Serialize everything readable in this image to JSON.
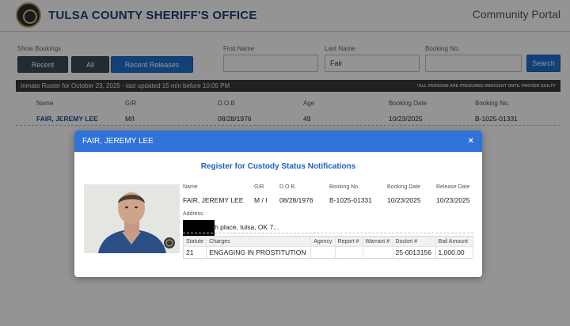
{
  "header": {
    "org_title": "TULSA COUNTY SHERIFF'S OFFICE",
    "portal_title": "Community Portal"
  },
  "filters": {
    "show_bookings_label": "Show Bookings",
    "buttons": [
      "Recent",
      "All",
      "Recent Releases"
    ],
    "first_name": {
      "label": "First Name",
      "value": ""
    },
    "last_name": {
      "label": "Last Name",
      "value": "Fair"
    },
    "booking_no": {
      "label": "Booking No.",
      "value": ""
    },
    "search_label": "Search"
  },
  "roster": {
    "status_text": "Inmate Roster for October 23, 2025 - last updated 15 min before 10:05 PM",
    "notice": "*ALL PERSONS ARE PRESUMED INNOCENT UNTIL PROVEN GUILTY",
    "columns": [
      "Name",
      "G/R",
      "D.O.B",
      "Age",
      "Booking Date",
      "Booking No."
    ],
    "rows": [
      {
        "name": "FAIR, JEREMY LEE",
        "gr": "M/I",
        "dob": "08/28/1976",
        "age": "49",
        "booking_date": "10/23/2025",
        "booking_no": "B-1025-01331"
      }
    ]
  },
  "modal": {
    "title": "FAIR, JEREMY LEE",
    "close_icon": "×",
    "register_link": "Register for Custody Status Notifications",
    "details": {
      "headers": [
        "Name",
        "G/R",
        "D.O.B.",
        "Booking No.",
        "Booking Date",
        "Release Date"
      ],
      "values": [
        "FAIR, JEREMY LEE",
        "M / I",
        "08/28/1976",
        "B-1025-01331",
        "10/23/2025",
        "10/23/2025"
      ]
    },
    "address_label": "Address",
    "address_value": "8th place, tulsa, OK 7...",
    "charges": {
      "headers": [
        "Statute",
        "Charges",
        "Agency",
        "Report #",
        "Warrant #",
        "Docket #",
        "Bail Amount"
      ],
      "rows": [
        [
          "21",
          "ENGAGING IN PROSTITUTION",
          "",
          "",
          "",
          "25-0013156",
          "1,000.00"
        ]
      ]
    }
  },
  "colors": {
    "brand_blue": "#1c3f75",
    "button_blue": "#1f6fd1",
    "modal_header": "#2f73d8",
    "link_blue": "#1f5fbf"
  },
  "icons": {
    "seal": "sheriff-seal-logo",
    "close": "close-icon"
  }
}
